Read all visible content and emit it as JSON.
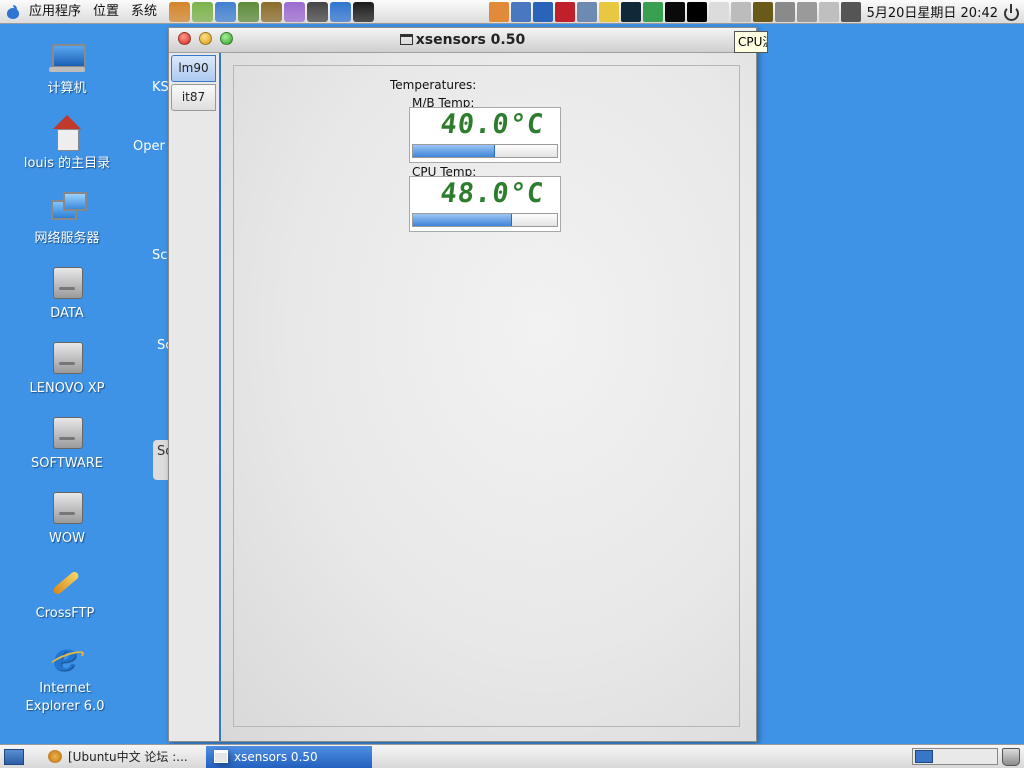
{
  "top_panel": {
    "menus": [
      "应用程序",
      "位置",
      "系统"
    ],
    "launcher_colors": [
      "#d4842a",
      "#7bb24a",
      "#3f7fd0",
      "#5c8a3a",
      "#8a6c2a",
      "#9b6ad0",
      "#444444",
      "#2f74d0",
      "#1a1a1a"
    ],
    "tray_colors": [
      "#e08a3a",
      "#4a78c0",
      "#2a64b8",
      "#c0202a",
      "#6d8ab0",
      "#e8c840",
      "#102838",
      "#38a050",
      "#0a0a0a",
      "#000000",
      "#dcdcdc",
      "#bcbcbc",
      "#6a5a1a",
      "#8a8a8a",
      "#9a9a9a",
      "#bfbfbf",
      "#555555"
    ],
    "clock": "5月20日星期日  20:42"
  },
  "desktop": {
    "icons": [
      {
        "label": "计算机",
        "icon": "computer-icon"
      },
      {
        "label": "louis 的主目录",
        "icon": "home-folder-icon"
      },
      {
        "label": "网络服务器",
        "icon": "network-servers-icon"
      },
      {
        "label": "DATA",
        "icon": "drive-icon"
      },
      {
        "label": "LENOVO XP",
        "icon": "drive-icon"
      },
      {
        "label": "SOFTWARE",
        "icon": "drive-icon"
      },
      {
        "label": "WOW",
        "icon": "drive-icon"
      },
      {
        "label": "CrossFTP",
        "icon": "crossftp-icon"
      },
      {
        "label": "Internet Explorer 6.0",
        "icon": "internet-explorer-icon"
      }
    ],
    "background_window_texts": [
      "KS",
      "Oper",
      "Sc",
      "Sc",
      "Sc"
    ]
  },
  "tooltip": "CPU温",
  "window": {
    "title": "xsensors 0.50",
    "tabs": [
      "lm90",
      "it87"
    ],
    "active_tab": 0,
    "heading": "Temperatures:",
    "sensors": [
      {
        "label": "M/B Temp:",
        "value": "40.0°C",
        "level": 0.56
      },
      {
        "label": "CPU Temp:",
        "value": "48.0°C",
        "level": 0.68
      }
    ]
  },
  "taskbar": {
    "tasks": [
      {
        "label": "[Ubuntu中文 论坛 :...",
        "active": false
      },
      {
        "label": "xsensors 0.50",
        "active": true
      }
    ]
  },
  "colors": {
    "desktop_bg": "#3f93e6",
    "accent": "#3a76c8",
    "lcd_text": "#2e7d2e"
  }
}
